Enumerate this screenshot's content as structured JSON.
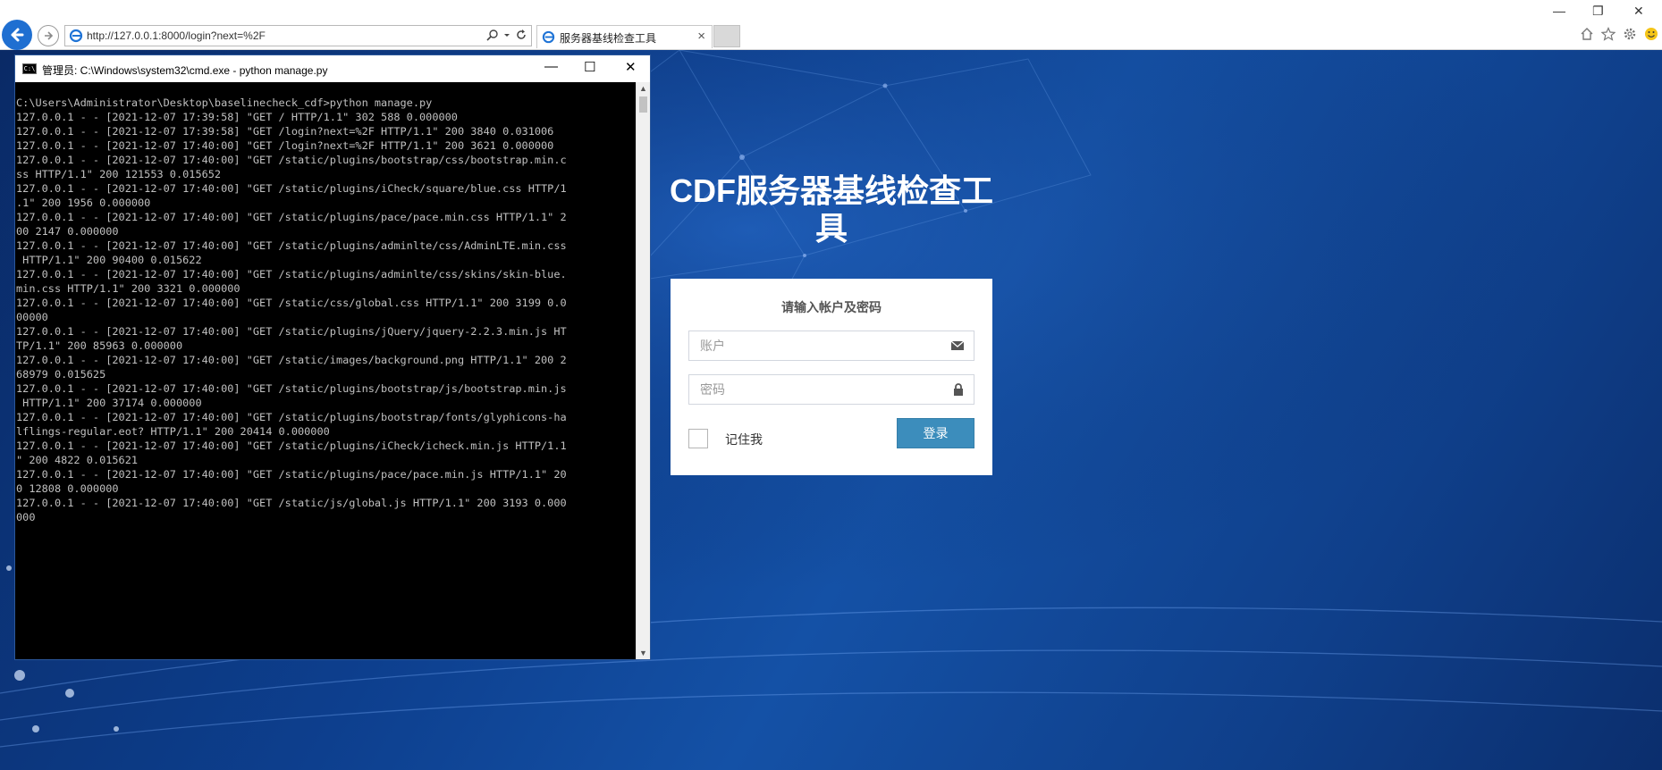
{
  "browser": {
    "address_url": "http://127.0.0.1:8000/login?next=%2F",
    "tab_title": "服务器基线检查工具",
    "tab_close": "×",
    "window_controls": [
      "—",
      "❐",
      "✕"
    ]
  },
  "cmd": {
    "title": "管理员: C:\\Windows\\system32\\cmd.exe - python  manage.py",
    "icon_text": "C:\\",
    "minimize": "—",
    "maximize": "☐",
    "close": "✕",
    "lines": [
      "C:\\Users\\Administrator\\Desktop\\baselinecheck_cdf>python manage.py",
      "127.0.0.1 - - [2021-12-07 17:39:58] \"GET / HTTP/1.1\" 302 588 0.000000",
      "127.0.0.1 - - [2021-12-07 17:39:58] \"GET /login?next=%2F HTTP/1.1\" 200 3840 0.031006",
      "127.0.0.1 - - [2021-12-07 17:40:00] \"GET /login?next=%2F HTTP/1.1\" 200 3621 0.000000",
      "127.0.0.1 - - [2021-12-07 17:40:00] \"GET /static/plugins/bootstrap/css/bootstrap.min.c",
      "ss HTTP/1.1\" 200 121553 0.015652",
      "127.0.0.1 - - [2021-12-07 17:40:00] \"GET /static/plugins/iCheck/square/blue.css HTTP/1",
      ".1\" 200 1956 0.000000",
      "127.0.0.1 - - [2021-12-07 17:40:00] \"GET /static/plugins/pace/pace.min.css HTTP/1.1\" 2",
      "00 2147 0.000000",
      "127.0.0.1 - - [2021-12-07 17:40:00] \"GET /static/plugins/adminlte/css/AdminLTE.min.css",
      " HTTP/1.1\" 200 90400 0.015622",
      "127.0.0.1 - - [2021-12-07 17:40:00] \"GET /static/plugins/adminlte/css/skins/skin-blue.",
      "min.css HTTP/1.1\" 200 3321 0.000000",
      "127.0.0.1 - - [2021-12-07 17:40:00] \"GET /static/css/global.css HTTP/1.1\" 200 3199 0.0",
      "00000",
      "127.0.0.1 - - [2021-12-07 17:40:00] \"GET /static/plugins/jQuery/jquery-2.2.3.min.js HT",
      "TP/1.1\" 200 85963 0.000000",
      "127.0.0.1 - - [2021-12-07 17:40:00] \"GET /static/images/background.png HTTP/1.1\" 200 2",
      "68979 0.015625",
      "127.0.0.1 - - [2021-12-07 17:40:00] \"GET /static/plugins/bootstrap/js/bootstrap.min.js",
      " HTTP/1.1\" 200 37174 0.000000",
      "127.0.0.1 - - [2021-12-07 17:40:00] \"GET /static/plugins/bootstrap/fonts/glyphicons-ha",
      "lflings-regular.eot? HTTP/1.1\" 200 20414 0.000000",
      "127.0.0.1 - - [2021-12-07 17:40:00] \"GET /static/plugins/iCheck/icheck.min.js HTTP/1.1",
      "\" 200 4822 0.015621",
      "127.0.0.1 - - [2021-12-07 17:40:00] \"GET /static/plugins/pace/pace.min.js HTTP/1.1\" 20",
      "0 12808 0.000000",
      "127.0.0.1 - - [2021-12-07 17:40:00] \"GET /static/js/global.js HTTP/1.1\" 200 3193 0.000",
      "000"
    ]
  },
  "login": {
    "title_line1": "CDF服务器基线检查工",
    "title_line2": "具",
    "message": "请输入帐户及密码",
    "username_placeholder": "账户",
    "password_placeholder": "密码",
    "remember_label": "记住我",
    "submit_label": "登录"
  },
  "colors": {
    "background": "#0d3f8e",
    "button": "#3c8dbc",
    "browser_back": "#1f6fd1"
  }
}
